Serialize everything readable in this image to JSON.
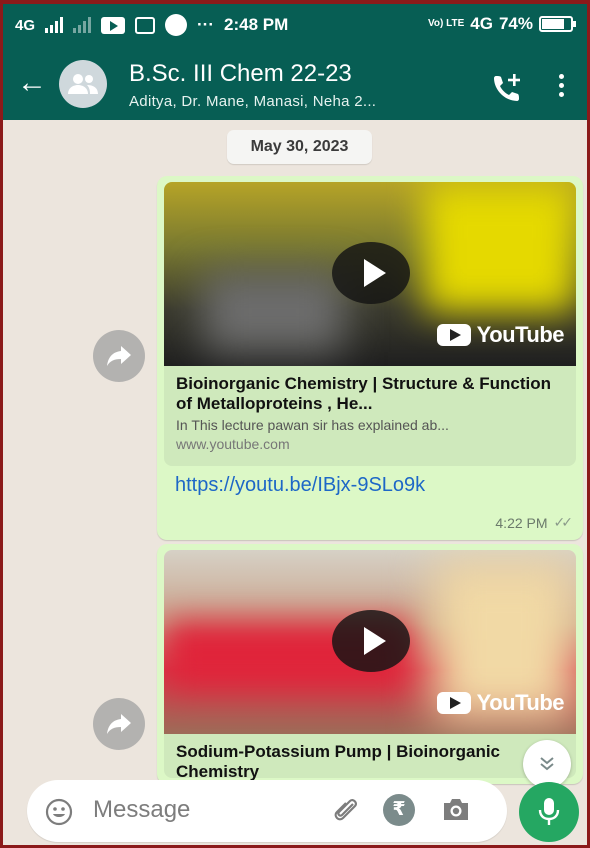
{
  "status_bar": {
    "network_left": "4G",
    "time": "2:48 PM",
    "network_right": "4G",
    "volte": "Vo) LTE",
    "battery": "74%",
    "more": "···"
  },
  "header": {
    "title": "B.Sc. III Chem 22-23",
    "subtitle": "Aditya, Dr. Mane, Manasi, Neha 2..."
  },
  "chat": {
    "date_chip": "May 30, 2023",
    "messages": [
      {
        "preview_title": "Bioinorganic Chemistry | Structure & Function of Metalloproteins , He...",
        "preview_description": "In This lecture pawan sir has explained ab...",
        "preview_site": "www.youtube.com",
        "link": "https://youtu.be/IBjx-9SLo9k",
        "time": "4:22 PM",
        "ticks": "✓✓",
        "thumb_label": "YouTube"
      },
      {
        "preview_title": "Sodium-Potassium Pump | Bioinorganic Chemistry",
        "thumb_label": "YouTube"
      }
    ]
  },
  "input": {
    "placeholder": "Message",
    "rupee": "₹"
  },
  "colors": {
    "header": "#075e54",
    "bubble_out": "#dcf8c6",
    "link": "#1d67c7",
    "mic": "#25a762"
  }
}
